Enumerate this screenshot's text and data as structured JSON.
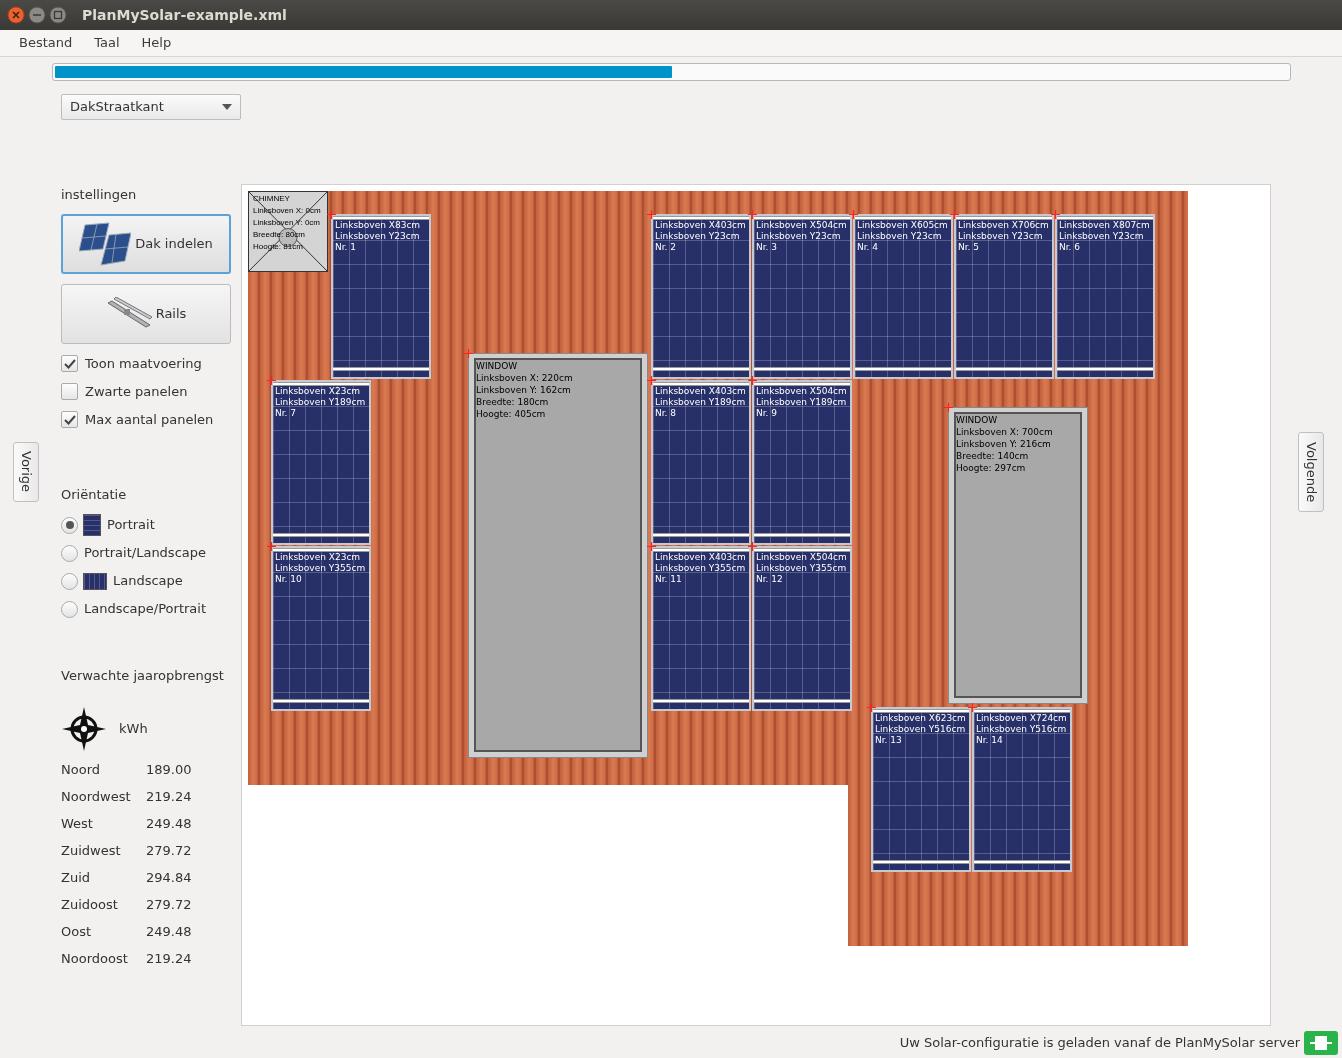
{
  "window": {
    "title": "PlanMySolar-example.xml"
  },
  "menu": [
    "Bestand",
    "Taal",
    "Help"
  ],
  "progress": {
    "level": 0.5
  },
  "roof_select": {
    "value": "DakStraatkant"
  },
  "sidebar": {
    "heading": "instellingen",
    "tools": [
      {
        "label": "Dak indelen",
        "kind": "panels",
        "selected": true
      },
      {
        "label": "Rails",
        "kind": "rails",
        "selected": false
      }
    ],
    "options": [
      {
        "label": "Toon maatvoering",
        "checked": true
      },
      {
        "label": "Zwarte panelen",
        "checked": false
      },
      {
        "label": "Max aantal panelen",
        "checked": true
      }
    ],
    "orientation_heading": "Oriëntatie",
    "orientations": [
      {
        "label": "Portrait",
        "selected": true,
        "kind": "portrait"
      },
      {
        "label": "Portrait/Landscape",
        "selected": false,
        "kind": "mixed"
      },
      {
        "label": "Landscape",
        "selected": false,
        "kind": "landscape"
      },
      {
        "label": "Landscape/Portrait",
        "selected": false,
        "kind": "mixed"
      }
    ],
    "yield_heading": "Verwachte jaaropbrengst",
    "yield_unit": "kWh",
    "yields": [
      {
        "direction": "Noord",
        "value": "189.00"
      },
      {
        "direction": "Noordwest",
        "value": "219.24"
      },
      {
        "direction": "West",
        "value": "249.48"
      },
      {
        "direction": "Zuidwest",
        "value": "279.72"
      },
      {
        "direction": "Zuid",
        "value": "294.84"
      },
      {
        "direction": "Zuidoost",
        "value": "279.72"
      },
      {
        "direction": "Oost",
        "value": "249.48"
      },
      {
        "direction": "Noordoost",
        "value": "219.24"
      }
    ]
  },
  "prev_button": "Vorige",
  "next_button": "Volgende",
  "obstacles": [
    {
      "kind": "chimney",
      "lines": [
        "CHIMNEY",
        "Linksboven X: 0cm",
        "Linksboven Y: 0cm",
        "Breedte: 80cm",
        "Hoogte: 81cm"
      ]
    },
    {
      "kind": "window",
      "lines": [
        "WINDOW",
        "Linksboven X: 220cm",
        "Linksboven Y: 162cm",
        "Breedte: 180cm",
        "Hoogte: 405cm"
      ]
    },
    {
      "kind": "window",
      "lines": [
        "WINDOW",
        "Linksboven X: 700cm",
        "Linksboven Y: 216cm",
        "Breedte: 140cm",
        "Hoogte: 297cm"
      ]
    }
  ],
  "panels": [
    {
      "x_label": "Linksboven X83cm",
      "y_label": "Linksboven Y23cm",
      "number": "Nr. 1"
    },
    {
      "x_label": "Linksboven X403cm",
      "y_label": "Linksboven Y23cm",
      "number": "Nr. 2"
    },
    {
      "x_label": "Linksboven X504cm",
      "y_label": "Linksboven Y23cm",
      "number": "Nr. 3"
    },
    {
      "x_label": "Linksboven X605cm",
      "y_label": "Linksboven Y23cm",
      "number": "Nr. 4"
    },
    {
      "x_label": "Linksboven X706cm",
      "y_label": "Linksboven Y23cm",
      "number": "Nr. 5"
    },
    {
      "x_label": "Linksboven X807cm",
      "y_label": "Linksboven Y23cm",
      "number": "Nr. 6"
    },
    {
      "x_label": "Linksboven X23cm",
      "y_label": "Linksboven Y189cm",
      "number": "Nr. 7"
    },
    {
      "x_label": "Linksboven X403cm",
      "y_label": "Linksboven Y189cm",
      "number": "Nr. 8"
    },
    {
      "x_label": "Linksboven X504cm",
      "y_label": "Linksboven Y189cm",
      "number": "Nr. 9"
    },
    {
      "x_label": "Linksboven X23cm",
      "y_label": "Linksboven Y355cm",
      "number": "Nr. 10"
    },
    {
      "x_label": "Linksboven X403cm",
      "y_label": "Linksboven Y355cm",
      "number": "Nr. 11"
    },
    {
      "x_label": "Linksboven X504cm",
      "y_label": "Linksboven Y355cm",
      "number": "Nr. 12"
    },
    {
      "x_label": "Linksboven X623cm",
      "y_label": "Linksboven Y516cm",
      "number": "Nr. 13"
    },
    {
      "x_label": "Linksboven X724cm",
      "y_label": "Linksboven Y516cm",
      "number": "Nr. 14"
    }
  ],
  "status": "Uw Solar-configuratie is geladen vanaf de PlanMySolar server"
}
